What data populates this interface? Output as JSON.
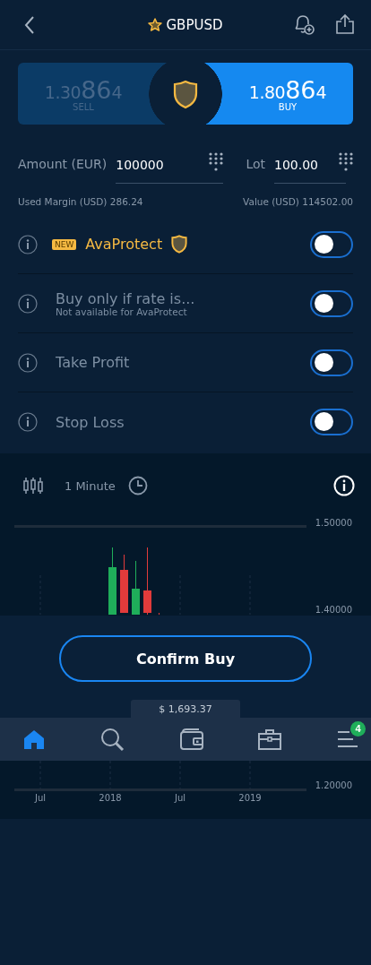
{
  "header": {
    "symbol": "GBPUSD",
    "favorite": true
  },
  "quotes": [
    {
      "side": "SELL",
      "lead": "1.30",
      "pips": "86",
      "tail": "4",
      "selected": false
    },
    {
      "side": "BUY",
      "lead": "1.80",
      "pips": "86",
      "tail": "4",
      "selected": true
    }
  ],
  "amount": {
    "label": "Amount (EUR)",
    "value": "100000"
  },
  "lot": {
    "label": "Lot",
    "value": "100.00"
  },
  "used_margin": "Used Margin (USD) 286.24",
  "value_usd": "Value (USD) 114502.00",
  "options": [
    {
      "kind": "protect",
      "badge": "NEW",
      "label": "AvaProtect",
      "on": false
    },
    {
      "kind": "plain",
      "label": "Buy only if rate is...",
      "subtitle": "Not available for AvaProtect",
      "on": false
    },
    {
      "kind": "plain",
      "label": "Take Profit",
      "on": false
    },
    {
      "kind": "plain",
      "label": "Stop Loss",
      "on": false
    }
  ],
  "chart": {
    "timeframe": "1 Minute",
    "top_axis_labels": [
      "1.50000",
      "1.40000"
    ],
    "bottom_axis_label": "1.20000",
    "x_labels": [
      "Jul",
      "2018",
      "Jul",
      "2019"
    ]
  },
  "confirm_button": "Confirm Buy",
  "balance": "$ 1,693.37",
  "nav": [
    {
      "kind": "home",
      "selected": true
    },
    {
      "kind": "search",
      "selected": false
    },
    {
      "kind": "wallet",
      "selected": false
    },
    {
      "kind": "briefcase",
      "selected": false
    },
    {
      "kind": "menu",
      "selected": false,
      "badge": "4"
    }
  ]
}
